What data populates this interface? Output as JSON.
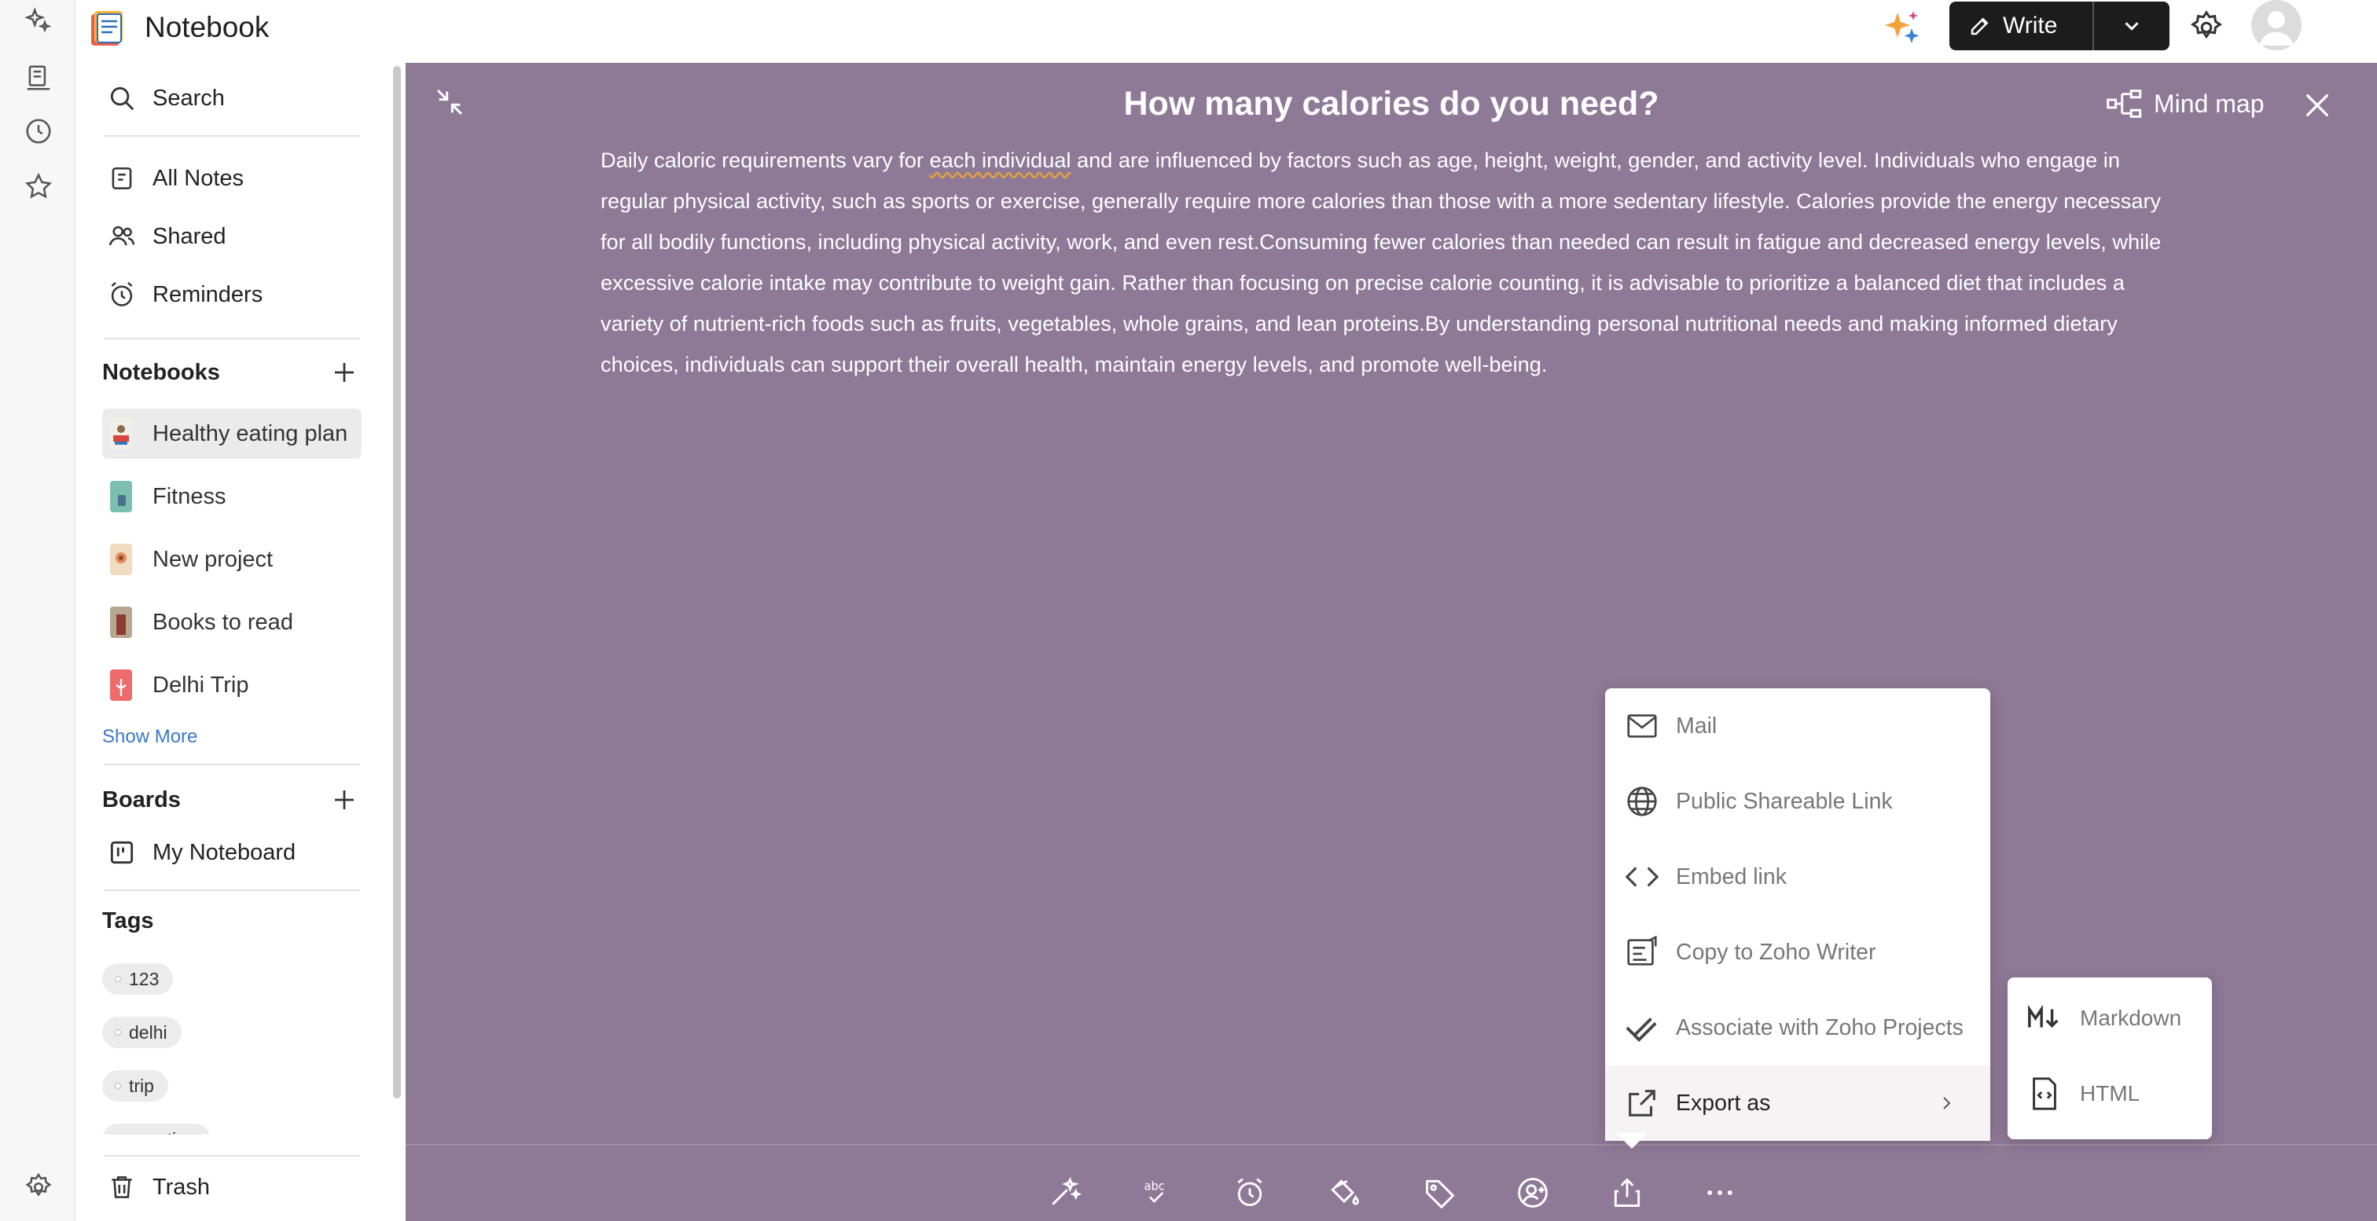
{
  "app": {
    "name": "Notebook"
  },
  "header": {
    "write_label": "Write"
  },
  "sidebar": {
    "search": "Search",
    "nav": [
      "All Notes",
      "Shared",
      "Reminders"
    ],
    "notebooks_title": "Notebooks",
    "notebooks": [
      "Healthy eating plan",
      "Fitness",
      "New project",
      "Books to read",
      "Delhi Trip"
    ],
    "show_more": "Show More",
    "boards_title": "Boards",
    "boards": [
      "My Noteboard"
    ],
    "tags_title": "Tags",
    "tags": [
      "123",
      "delhi",
      "trip",
      "vacation"
    ],
    "trash": "Trash"
  },
  "note": {
    "title": "How many calories do you need?",
    "mindmap_label": "Mind map",
    "body_before": "Daily caloric requirements vary for ",
    "body_spell": "each individual",
    "body_after": " and are influenced by factors such as age, height, weight, gender, and activity level. Individuals who engage in regular physical activity, such as sports or exercise, generally require more calories than those with a more sedentary lifestyle. Calories provide the energy necessary for all bodily functions, including physical activity, work, and even rest.Consuming fewer calories than needed can result in fatigue and decreased energy levels, while excessive calorie intake may contribute to weight gain. Rather than focusing on precise calorie counting, it is advisable to prioritize a balanced diet that includes a variety of nutrient-rich foods such as fruits, vegetables, whole grains, and lean proteins.By understanding personal nutritional needs and making informed dietary choices, individuals can support their overall health, maintain energy levels, and promote well-being.",
    "background": "#8e7996"
  },
  "share_menu": {
    "items": [
      "Mail",
      "Public Shareable Link",
      "Embed link",
      "Copy to Zoho Writer",
      "Associate with Zoho Projects",
      "Export as"
    ]
  },
  "export_menu": {
    "items": [
      "Markdown",
      "HTML"
    ]
  }
}
